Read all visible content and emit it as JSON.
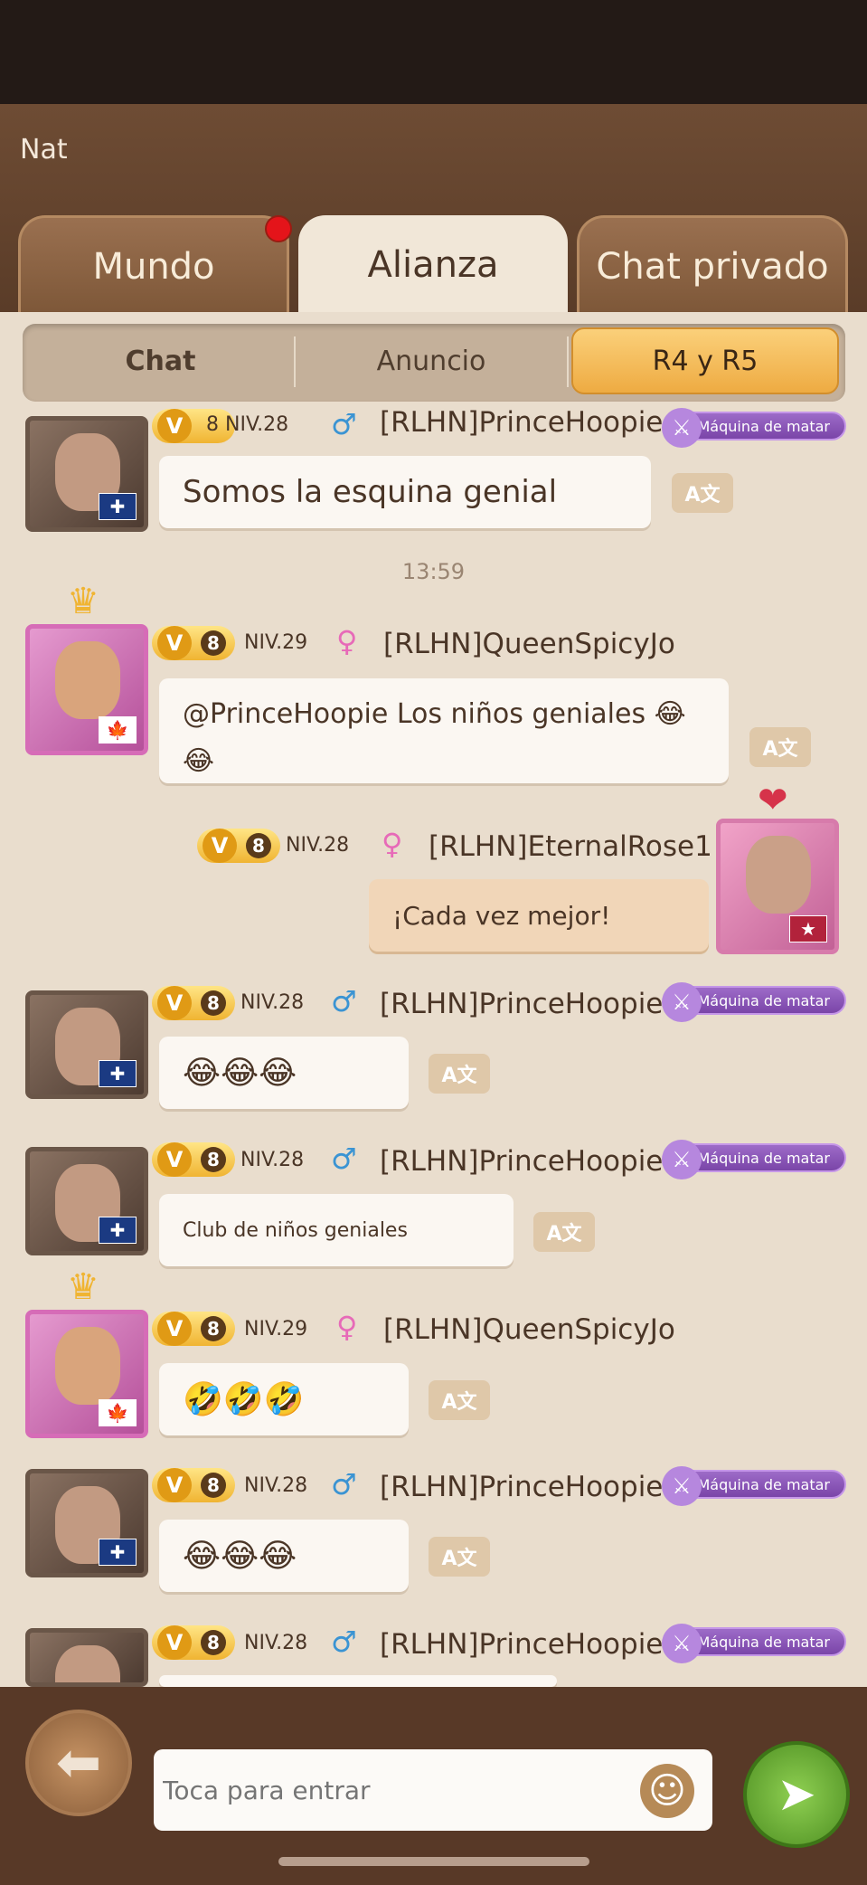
{
  "header": {
    "user_name": "Nat"
  },
  "tabs": [
    {
      "label": "Mundo",
      "active": false,
      "has_notification": true
    },
    {
      "label": "Alianza",
      "active": true,
      "has_notification": false
    },
    {
      "label": "Chat privado",
      "active": false,
      "has_notification": false
    }
  ],
  "subtabs": [
    {
      "label": "Chat",
      "active": false
    },
    {
      "label": "Anuncio",
      "active": false
    },
    {
      "label": "R4 y R5",
      "active": true
    }
  ],
  "badge_label": "Máquina de matar",
  "timestamp": "13:59",
  "messages": [
    {
      "user": "[RLHN]PrinceHoopie",
      "level": "NIV.28",
      "vip": "8",
      "gender": "male",
      "flag": "uk",
      "text": "Somos la esquina genial"
    },
    {
      "user": "[RLHN]QueenSpicyJo",
      "level": "NIV.29",
      "vip": "8",
      "gender": "female",
      "flag": "ca",
      "text": "@PrinceHoopie Los niños geniales 😂😂"
    },
    {
      "user": "[RLHN]EternalRose1",
      "level": "NIV.28",
      "vip": "8",
      "gender": "female",
      "flag": "us",
      "text": "¡Cada vez mejor!",
      "own": true
    },
    {
      "user": "[RLHN]PrinceHoopie",
      "level": "NIV.28",
      "vip": "8",
      "gender": "male",
      "flag": "uk",
      "text": "😂😂😂"
    },
    {
      "user": "[RLHN]PrinceHoopie",
      "level": "NIV.28",
      "vip": "8",
      "gender": "male",
      "flag": "uk",
      "text": "Club de niños geniales"
    },
    {
      "user": "[RLHN]QueenSpicyJo",
      "level": "NIV.29",
      "vip": "8",
      "gender": "female",
      "flag": "ca",
      "text": "🤣🤣🤣"
    },
    {
      "user": "[RLHN]PrinceHoopie",
      "level": "NIV.28",
      "vip": "8",
      "gender": "male",
      "flag": "uk",
      "text": "😂😂😂"
    },
    {
      "user": "[RLHN]PrinceHoopie",
      "level": "NIV.28",
      "vip": "8",
      "gender": "male",
      "flag": "uk",
      "text": ""
    }
  ],
  "input": {
    "placeholder": "Toca para entrar"
  },
  "icons": {
    "back": "back-arrow-icon",
    "send": "send-icon",
    "emoji": "emoji-icon",
    "translate": "translate-icon"
  }
}
